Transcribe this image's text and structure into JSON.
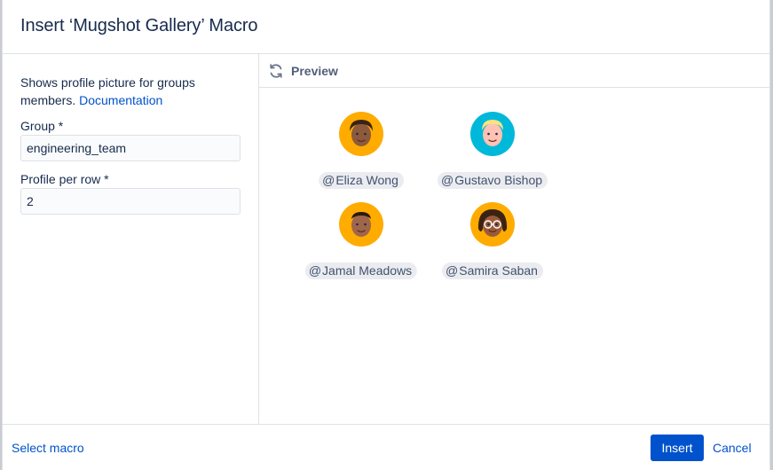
{
  "dialog": {
    "title": "Insert ‘Mugshot Gallery’ Macro"
  },
  "form": {
    "description": "Shows profile picture for groups members.",
    "documentation_link": "Documentation",
    "group_label": "Group *",
    "group_value": "engineering_team",
    "per_row_label": "Profile per row *",
    "per_row_value": "2"
  },
  "preview": {
    "label": "Preview",
    "profiles": [
      {
        "at": "@",
        "name": "Eliza Wong",
        "bg": "#ffab00",
        "skin": "#8d5a3c",
        "hair": "#3b2314",
        "icon": "avatar-eliza-icon"
      },
      {
        "at": "@",
        "name": "Gustavo Bishop",
        "bg": "#00b8d9",
        "skin": "#ffc2b3",
        "hair": "#ffe380",
        "icon": "avatar-gustavo-icon"
      },
      {
        "at": "@",
        "name": "Jamal Meadows",
        "bg": "#ffab00",
        "skin": "#a0664a",
        "hair": "#2b1a10",
        "icon": "avatar-jamal-icon"
      },
      {
        "at": "@",
        "name": "Samira Saban",
        "bg": "#ffab00",
        "skin": "#9a5a3a",
        "hair": "#3b2314",
        "icon": "avatar-samira-icon"
      }
    ]
  },
  "footer": {
    "select_macro": "Select macro",
    "insert": "Insert",
    "cancel": "Cancel"
  },
  "colors": {
    "primary": "#0052cc",
    "border": "#dfe1e6",
    "mention_bg": "#ebecf0"
  }
}
